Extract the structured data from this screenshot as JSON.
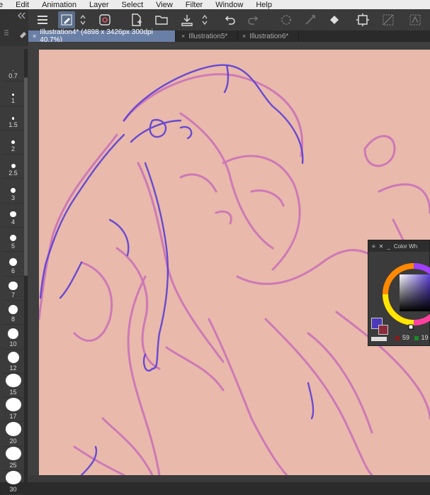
{
  "menu": {
    "items": [
      "e",
      "Edit",
      "Animation",
      "Layer",
      "Select",
      "View",
      "Filter",
      "Window",
      "Help"
    ]
  },
  "tabs": [
    {
      "label": "Illustration4* (4898 x 3426px 300dpi 40.7%)",
      "active": true
    },
    {
      "label": "Illustration5*",
      "active": false
    },
    {
      "label": "Illustration6*",
      "active": false
    }
  ],
  "tab_close": "×",
  "brush_sizes": [
    "0.7",
    "1",
    "1.5",
    "2",
    "2.5",
    "3",
    "4",
    "5",
    "6",
    "7",
    "8",
    "10",
    "12",
    "15",
    "17",
    "20",
    "25",
    "30"
  ],
  "color_wheel": {
    "title": "Color Wh",
    "close": "✕",
    "minimize": "_",
    "red_value": "59",
    "green_value": "19"
  },
  "colors": {
    "accent": "#6a7fa6",
    "canvas": "#e9b9ab",
    "sketch_pink": "#c96fb8",
    "sketch_blue": "#5b3fd6",
    "main_color": "#4a3ab8",
    "sub_color": "#8b2b3a"
  },
  "icons": {
    "toolbar": [
      "menu-icon",
      "pen-icon",
      "chevron-updown-icon",
      "spiral-icon",
      "new-file-icon",
      "open-folder-icon",
      "save-icon",
      "chevron-updown-icon",
      "undo-icon",
      "redo-icon",
      "loading-icon",
      "transform-icon",
      "fill-icon",
      "crop-icon",
      "no-select-icon",
      "cut-icon"
    ]
  }
}
